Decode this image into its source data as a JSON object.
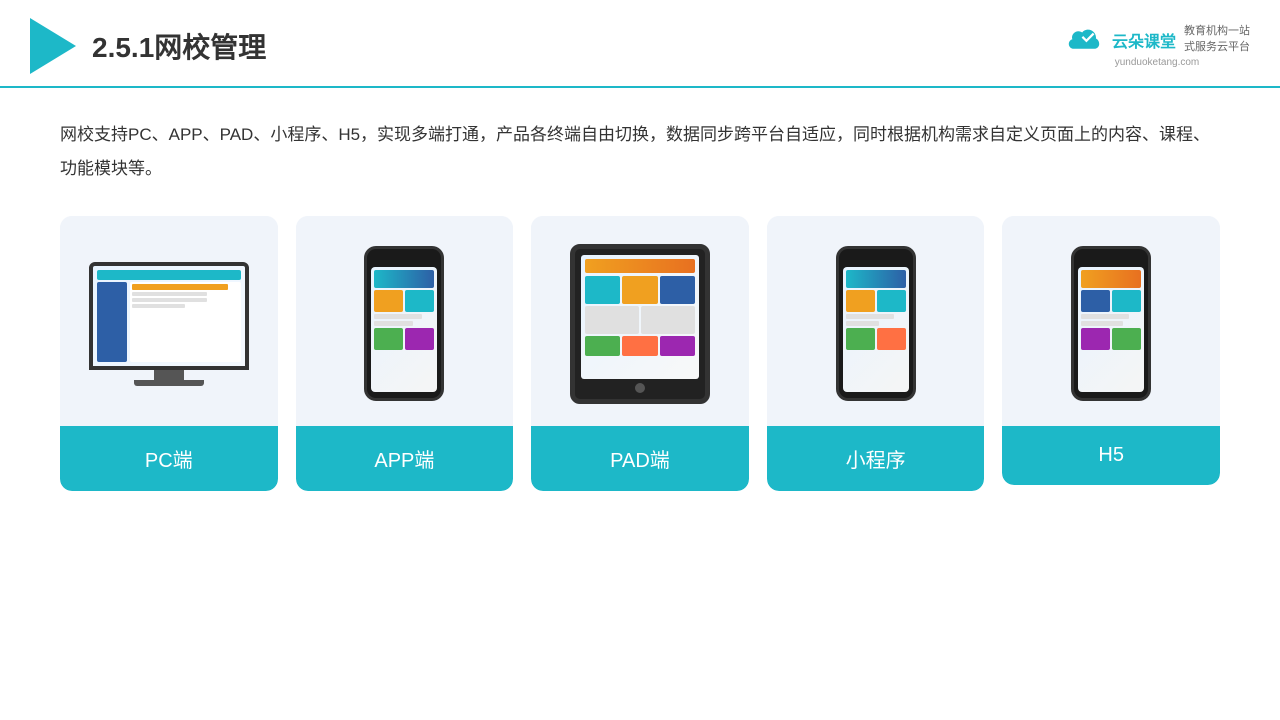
{
  "header": {
    "section_number": "2.5.1",
    "title": "网校管理",
    "brand_name": "云朵课堂",
    "brand_tagline_line1": "教育机构一站",
    "brand_tagline_line2": "式服务云平台",
    "brand_url": "yunduoketang.com"
  },
  "description": "网校支持PC、APP、PAD、小程序、H5，实现多端打通，产品各终端自由切换，数据同步跨平台自适应，同时根据机构需求自定义页面上的内容、课程、功能模块等。",
  "cards": [
    {
      "id": "pc",
      "label": "PC端",
      "type": "pc"
    },
    {
      "id": "app",
      "label": "APP端",
      "type": "phone"
    },
    {
      "id": "pad",
      "label": "PAD端",
      "type": "ipad"
    },
    {
      "id": "miniprogram",
      "label": "小程序",
      "type": "phone"
    },
    {
      "id": "h5",
      "label": "H5",
      "type": "phone"
    }
  ],
  "colors": {
    "accent": "#1db8c8",
    "dark": "#333",
    "card_bg": "#f0f4fa"
  }
}
